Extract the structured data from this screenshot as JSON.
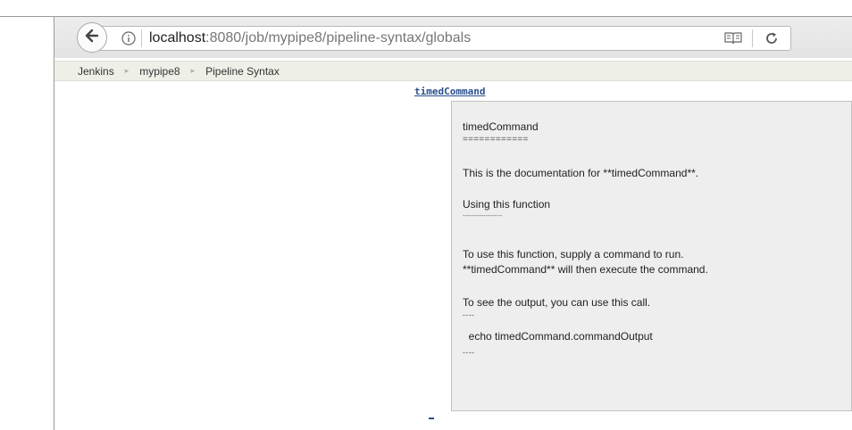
{
  "browser": {
    "url_host": "localhost",
    "url_rest": ":8080/job/mypipe8/pipeline-syntax/globals"
  },
  "breadcrumb": {
    "items": [
      "Jenkins",
      "mypipe8",
      "Pipeline Syntax"
    ]
  },
  "step_link": "timedCommand",
  "doc": {
    "lines": [
      "timedCommand",
      "============",
      "This is the documentation for **timedCommand**.",
      "Using this function",
      "-------------------",
      "To use this function, supply a command to run.",
      "**timedCommand** will then execute the command.",
      "To see the output, you can use this call.",
      "----",
      "  echo timedCommand.commandOutput",
      "----"
    ]
  },
  "colors": {
    "link": "#2a4f8e",
    "panel_bg": "#eeeeee",
    "breadcrumb_bg": "#eef0e8"
  }
}
